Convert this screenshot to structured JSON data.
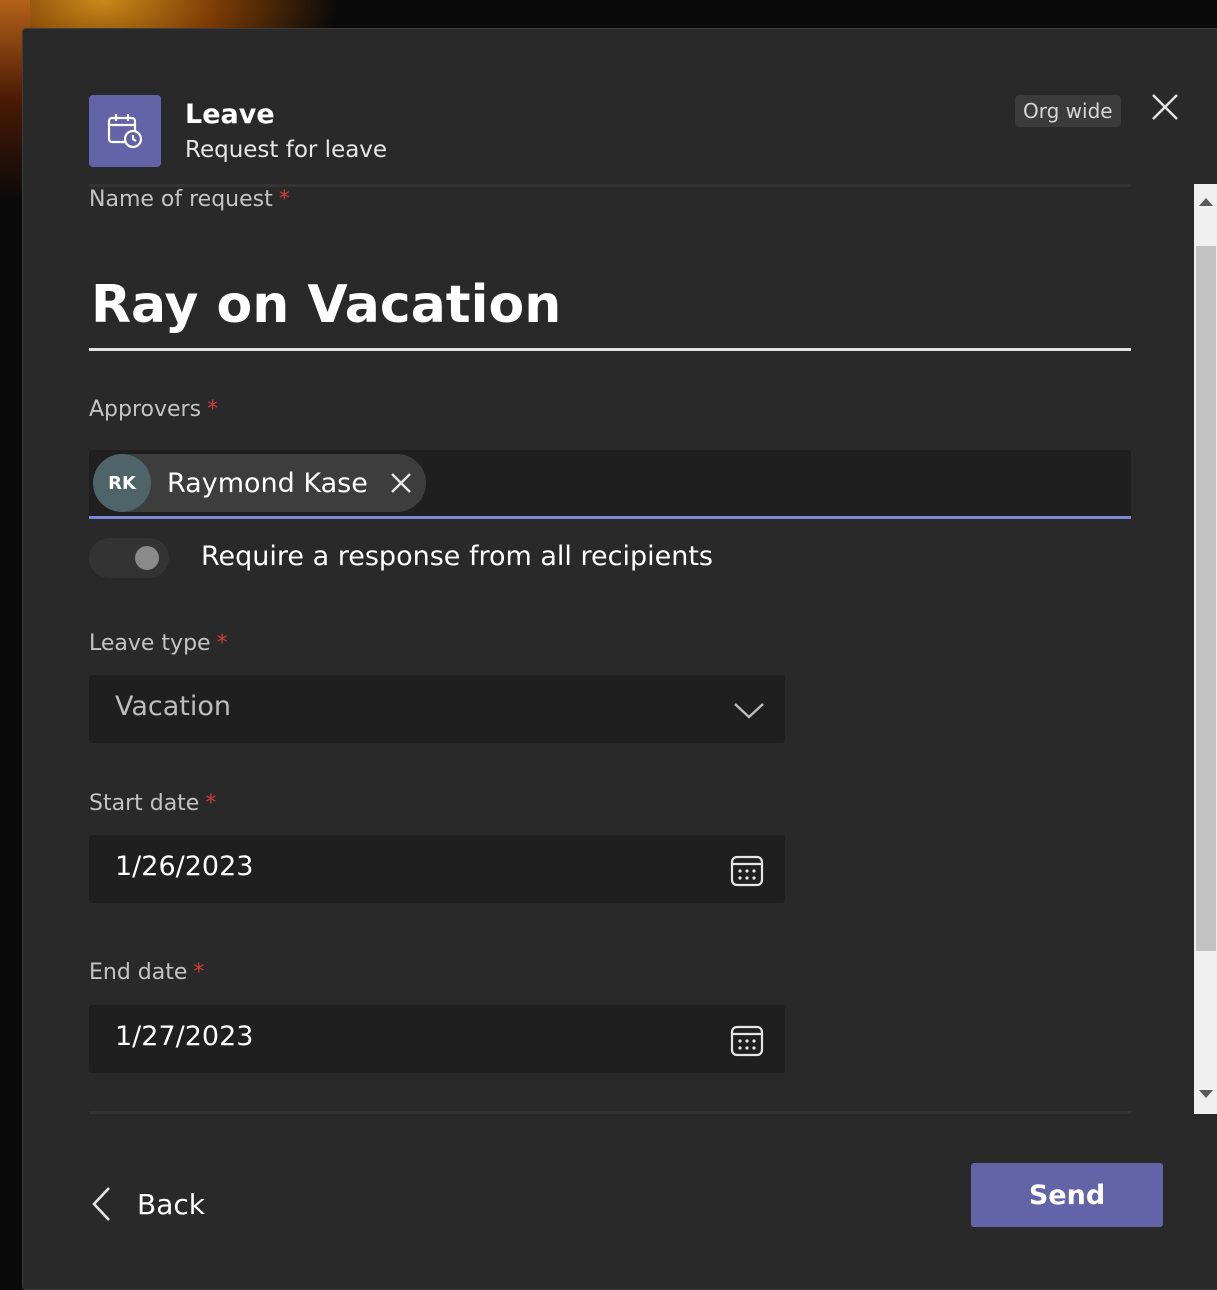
{
  "app": {
    "title": "Leave",
    "subtitle": "Request for leave",
    "scope_badge": "Org wide",
    "accent_color": "#6264a7"
  },
  "form": {
    "name_label": "Name of request",
    "name_value": "Ray on Vacation",
    "approvers_label": "Approvers",
    "approvers": [
      {
        "initials": "RK",
        "name": "Raymond Kase"
      }
    ],
    "require_all_label": "Require a response from all recipients",
    "require_all_enabled": false,
    "leave_type_label": "Leave type",
    "leave_type_value": "Vacation",
    "start_date_label": "Start date",
    "start_date_value": "1/26/2023",
    "end_date_label": "End date",
    "end_date_value": "1/27/2023",
    "required_marker": "*"
  },
  "footer": {
    "back_label": "Back",
    "send_label": "Send"
  },
  "icons": {
    "app": "calendar-clock-icon",
    "close": "close-icon",
    "remove": "close-icon",
    "dropdown": "chevron-down-icon",
    "date_picker": "calendar-icon",
    "back": "chevron-left-icon"
  }
}
